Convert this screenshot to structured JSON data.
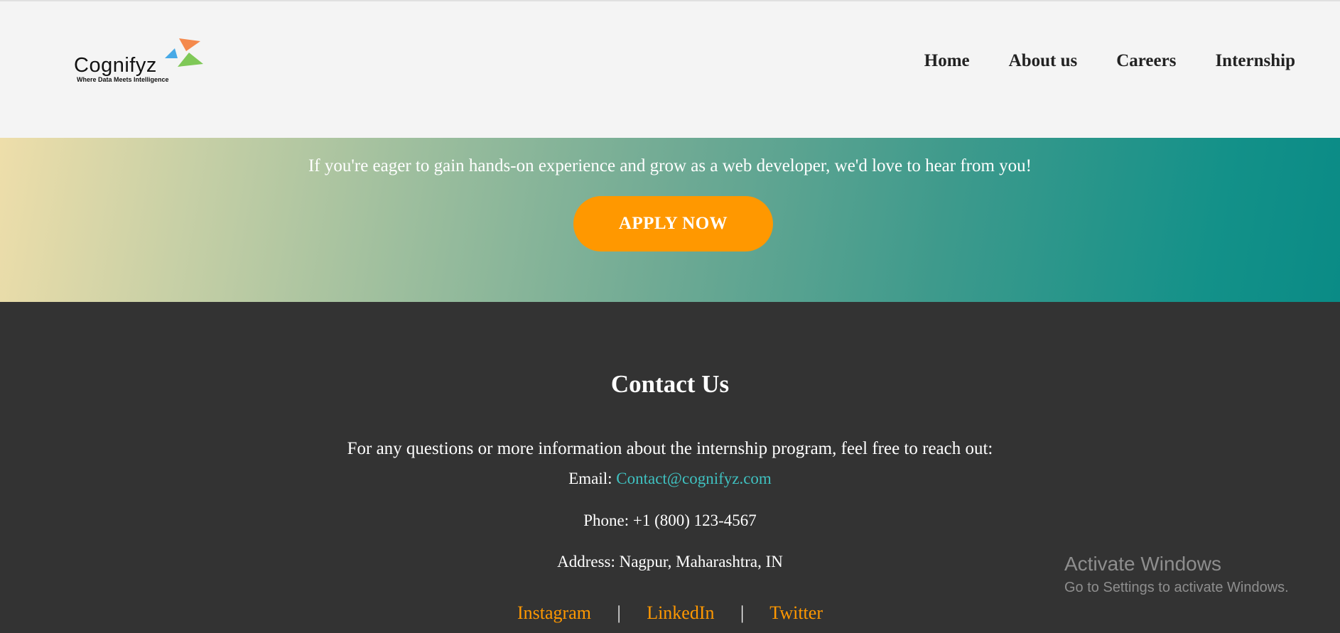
{
  "header": {
    "logo": {
      "wordmark": "Cognifyz",
      "tagline": "Where Data Meets Intelligence"
    },
    "nav": [
      {
        "label": "Home"
      },
      {
        "label": "About us"
      },
      {
        "label": "Careers"
      },
      {
        "label": "Internship"
      }
    ]
  },
  "hero": {
    "text": "If you're eager to gain hands-on experience and grow as a web developer, we'd love to hear from you!",
    "apply_label": "APPLY NOW"
  },
  "contact": {
    "heading": "Contact Us",
    "intro": "For any questions or more information about the internship program, feel free to reach out:",
    "email_label": "Email:",
    "email": "Contact@cognifyz.com",
    "phone": "Phone: +1 (800) 123-4567",
    "address": "Address: Nagpur, Maharashtra, IN",
    "social": [
      {
        "label": "Instagram"
      },
      {
        "label": "LinkedIn"
      },
      {
        "label": "Twitter"
      }
    ],
    "separator": "|"
  },
  "watermark": {
    "title": "Activate Windows",
    "subtitle": "Go to Settings to activate Windows."
  },
  "colors": {
    "accent_orange": "#ff9800",
    "footer_bg": "#333333",
    "link_teal": "#3fc1c0",
    "header_bg": "#f4f4f4"
  }
}
